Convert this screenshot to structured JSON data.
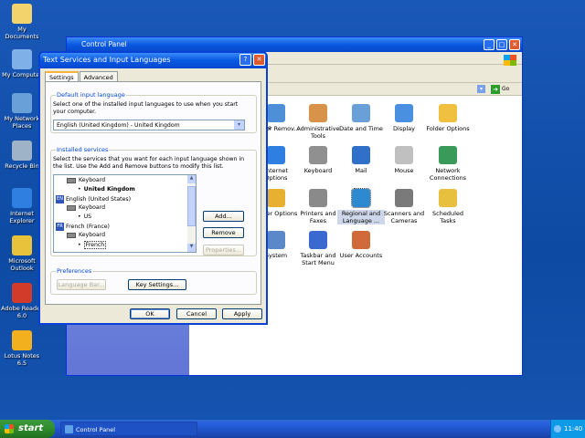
{
  "desktop": {
    "icons": [
      {
        "label": "My Documents",
        "color": "#f3d36b"
      },
      {
        "label": "My Computer",
        "color": "#7fb0e8"
      },
      {
        "label": "My Network Places",
        "color": "#6aa0d8"
      },
      {
        "label": "Recycle Bin",
        "color": "#9fb3c8"
      },
      {
        "label": "Internet Explorer",
        "color": "#2f7fe0"
      },
      {
        "label": "Microsoft Outlook",
        "color": "#e7c23a"
      },
      {
        "label": "Adobe Reader 6.0",
        "color": "#d23a2a"
      },
      {
        "label": "Lotus Notes 6.5",
        "color": "#f2b01e"
      }
    ]
  },
  "control_panel": {
    "title": "Control Panel",
    "go_label": "Go",
    "items": [
      {
        "label": "Add or Remov...",
        "color": "#4f8fd8"
      },
      {
        "label": "Administrative Tools",
        "color": "#d8924a"
      },
      {
        "label": "Date and Time",
        "color": "#6aa0d8"
      },
      {
        "label": "Display",
        "color": "#4a90e0"
      },
      {
        "label": "Folder Options",
        "color": "#f0c040"
      },
      {
        "label": "Internet Options",
        "color": "#2f7fe0"
      },
      {
        "label": "Keyboard",
        "color": "#909090"
      },
      {
        "label": "Mail",
        "color": "#3070c8"
      },
      {
        "label": "Mouse",
        "color": "#c0c0c0"
      },
      {
        "label": "Network Connections",
        "color": "#3a9a5a"
      },
      {
        "label": "Power Options",
        "color": "#e8b030"
      },
      {
        "label": "Printers and Faxes",
        "color": "#8a8a8a"
      },
      {
        "label": "Regional and Language ...",
        "color": "#2e8ad0"
      },
      {
        "label": "Scanners and Cameras",
        "color": "#7a7a7a"
      },
      {
        "label": "Scheduled Tasks",
        "color": "#e8c040"
      },
      {
        "label": "System",
        "color": "#5a88c8"
      },
      {
        "label": "Taskbar and Start Menu",
        "color": "#3a6ad0"
      },
      {
        "label": "User Accounts",
        "color": "#d06a3a"
      }
    ],
    "partial_label": "e"
  },
  "dialog": {
    "title": "Text Services and Input Languages",
    "help": "?",
    "close": "✕",
    "tabs": [
      "Settings",
      "Advanced"
    ],
    "default_group": {
      "title": "Default input language",
      "description": "Select one of the installed input languages to use when you start your computer.",
      "value": "English (United Kingdom) - United Kingdom"
    },
    "services_group": {
      "title": "Installed services",
      "description": "Select the services that you want for each input language shown in the list. Use the Add and Remove buttons to modify this list.",
      "tree": [
        {
          "text": "Keyboard",
          "kind": "kb",
          "indent": 1
        },
        {
          "text": "United Kingdom",
          "kind": "bold",
          "indent": 2
        },
        {
          "text": "English (United States)",
          "kind": "lang",
          "badge": "EN",
          "indent": 0
        },
        {
          "text": "Keyboard",
          "kind": "kb",
          "indent": 1
        },
        {
          "text": "US",
          "kind": "bullet",
          "indent": 2
        },
        {
          "text": "French (France)",
          "kind": "lang",
          "badge": "FR",
          "indent": 0
        },
        {
          "text": "Keyboard",
          "kind": "kb",
          "indent": 1
        },
        {
          "text": "French",
          "kind": "selected",
          "indent": 2
        }
      ],
      "add": "Add...",
      "remove": "Remove",
      "properties": "Properties..."
    },
    "preferences_group": {
      "title": "Preferences",
      "language_bar": "Language Bar...",
      "key_settings": "Key Settings..."
    },
    "ok": "OK",
    "cancel": "Cancel",
    "apply": "Apply"
  },
  "taskbar": {
    "start": "start",
    "task": "Control Panel",
    "clock": "11:40"
  }
}
